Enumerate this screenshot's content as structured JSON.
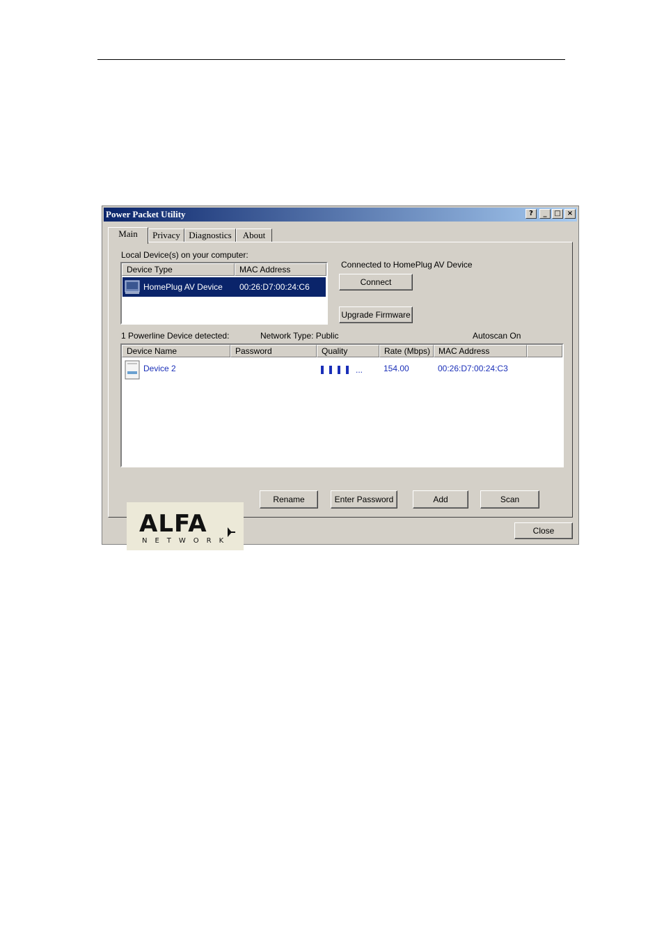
{
  "window": {
    "title": "Power Packet Utility",
    "help_label": "?",
    "min_label": "_",
    "max_label": "□",
    "close_label": "×"
  },
  "tabs": [
    "Main",
    "Privacy",
    "Diagnostics",
    "About"
  ],
  "local": {
    "label": "Local Device(s) on your computer:",
    "columns": [
      "Device Type",
      "MAC Address"
    ],
    "rows": [
      {
        "type": "HomePlug AV Device",
        "mac": "00:26:D7:00:24:C6",
        "selected": true
      }
    ],
    "status": "Connected to HomePlug AV Device",
    "connect_label": "Connect",
    "upgrade_label": "Upgrade Firmware"
  },
  "powerline": {
    "detected": "1 Powerline Device detected:",
    "network_type": "Network Type: Public",
    "autoscan": "Autoscan On",
    "columns": [
      "Device Name",
      "Password",
      "Quality",
      "Rate (Mbps)",
      "MAC Address"
    ],
    "rows": [
      {
        "name": "Device 2",
        "password": "",
        "quality_bars": 4,
        "quality_more": "...",
        "rate": "154.00",
        "mac": "00:26:D7:00:24:C3"
      }
    ]
  },
  "logo": {
    "main": "ALFA",
    "sub": "NETWORK"
  },
  "buttons": {
    "rename": "Rename",
    "enter_password": "Enter Password",
    "add": "Add",
    "scan": "Scan",
    "close": "Close"
  },
  "colors": {
    "title_start": "#0a246a",
    "title_end": "#a6caf0",
    "selection": "#0a246a",
    "link_blue": "#1a2fb8"
  }
}
